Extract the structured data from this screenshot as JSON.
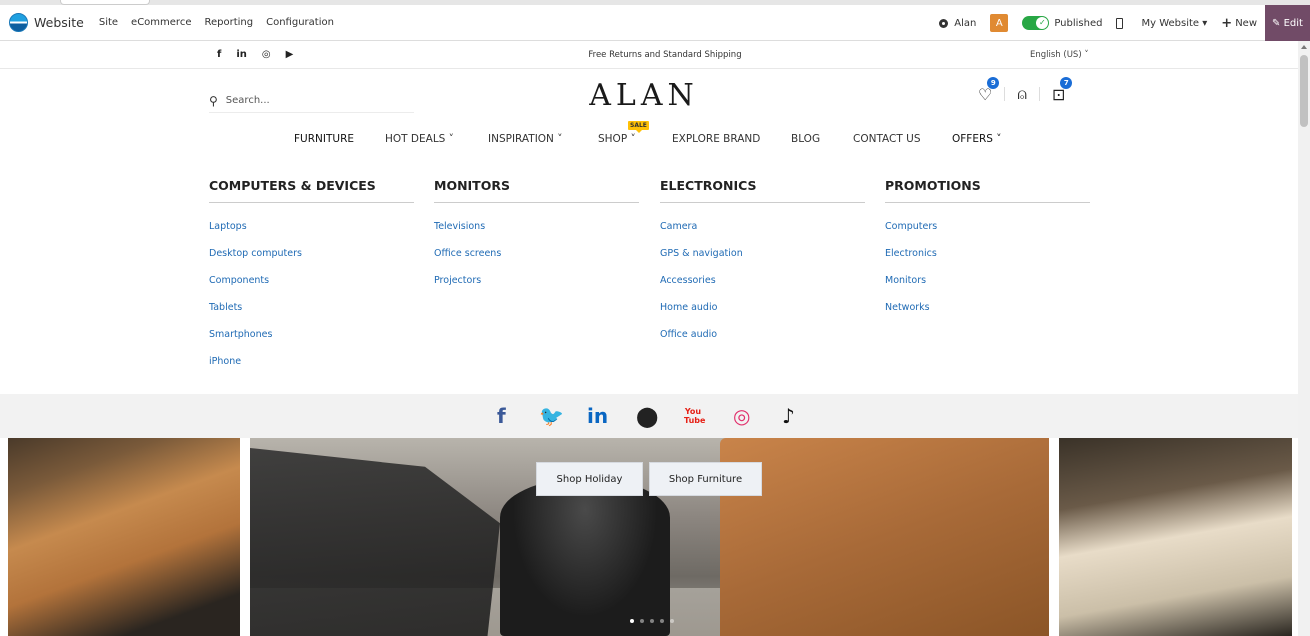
{
  "odoo_bar": {
    "app_name": "Website",
    "menu": [
      "Site",
      "eCommerce",
      "Reporting",
      "Configuration"
    ],
    "user": "Alan",
    "avatar_letter": "A",
    "published_label": "Published",
    "website_label": "My Website ▾",
    "new_label": "New",
    "edit_label": "Edit",
    "accent_color": "#714b67"
  },
  "header": {
    "social_top": [
      "f",
      "in",
      "◎",
      "▶"
    ],
    "promo_text": "Free Returns and Standard Shipping",
    "language": "English (US) ˅",
    "search_placeholder": "Search...",
    "logo": "ALAN",
    "wishlist_count": "9",
    "cart_count": "7"
  },
  "nav": {
    "items": [
      "FURNITURE",
      "HOT DEALS ˅",
      "INSPIRATION ˅",
      "SHOP ˅",
      "EXPLORE BRAND",
      "BLOG",
      "CONTACT US",
      "OFFERS ˅"
    ],
    "sale_badge": "SALE"
  },
  "mega_menu": {
    "columns": [
      {
        "title": "COMPUTERS & DEVICES",
        "links": [
          "Laptops",
          "Desktop computers",
          "Components",
          "Tablets",
          "Smartphones",
          "iPhone"
        ]
      },
      {
        "title": "MONITORS",
        "links": [
          "Televisions",
          "Office screens",
          "Projectors"
        ]
      },
      {
        "title": "ELECTRONICS",
        "links": [
          "Camera",
          "GPS & navigation",
          "Accessories",
          "Home audio",
          "Office audio"
        ]
      },
      {
        "title": "PROMOTIONS",
        "links": [
          "Computers",
          "Electronics",
          "Monitors",
          "Networks"
        ]
      }
    ]
  },
  "social_row": [
    "f",
    "🐦",
    "in",
    "⬤",
    "You Tube",
    "◎",
    "♪"
  ],
  "hero": {
    "buttons": [
      "Shop Holiday",
      "Shop Furniture"
    ],
    "slides": 5,
    "active_slide": 1
  }
}
